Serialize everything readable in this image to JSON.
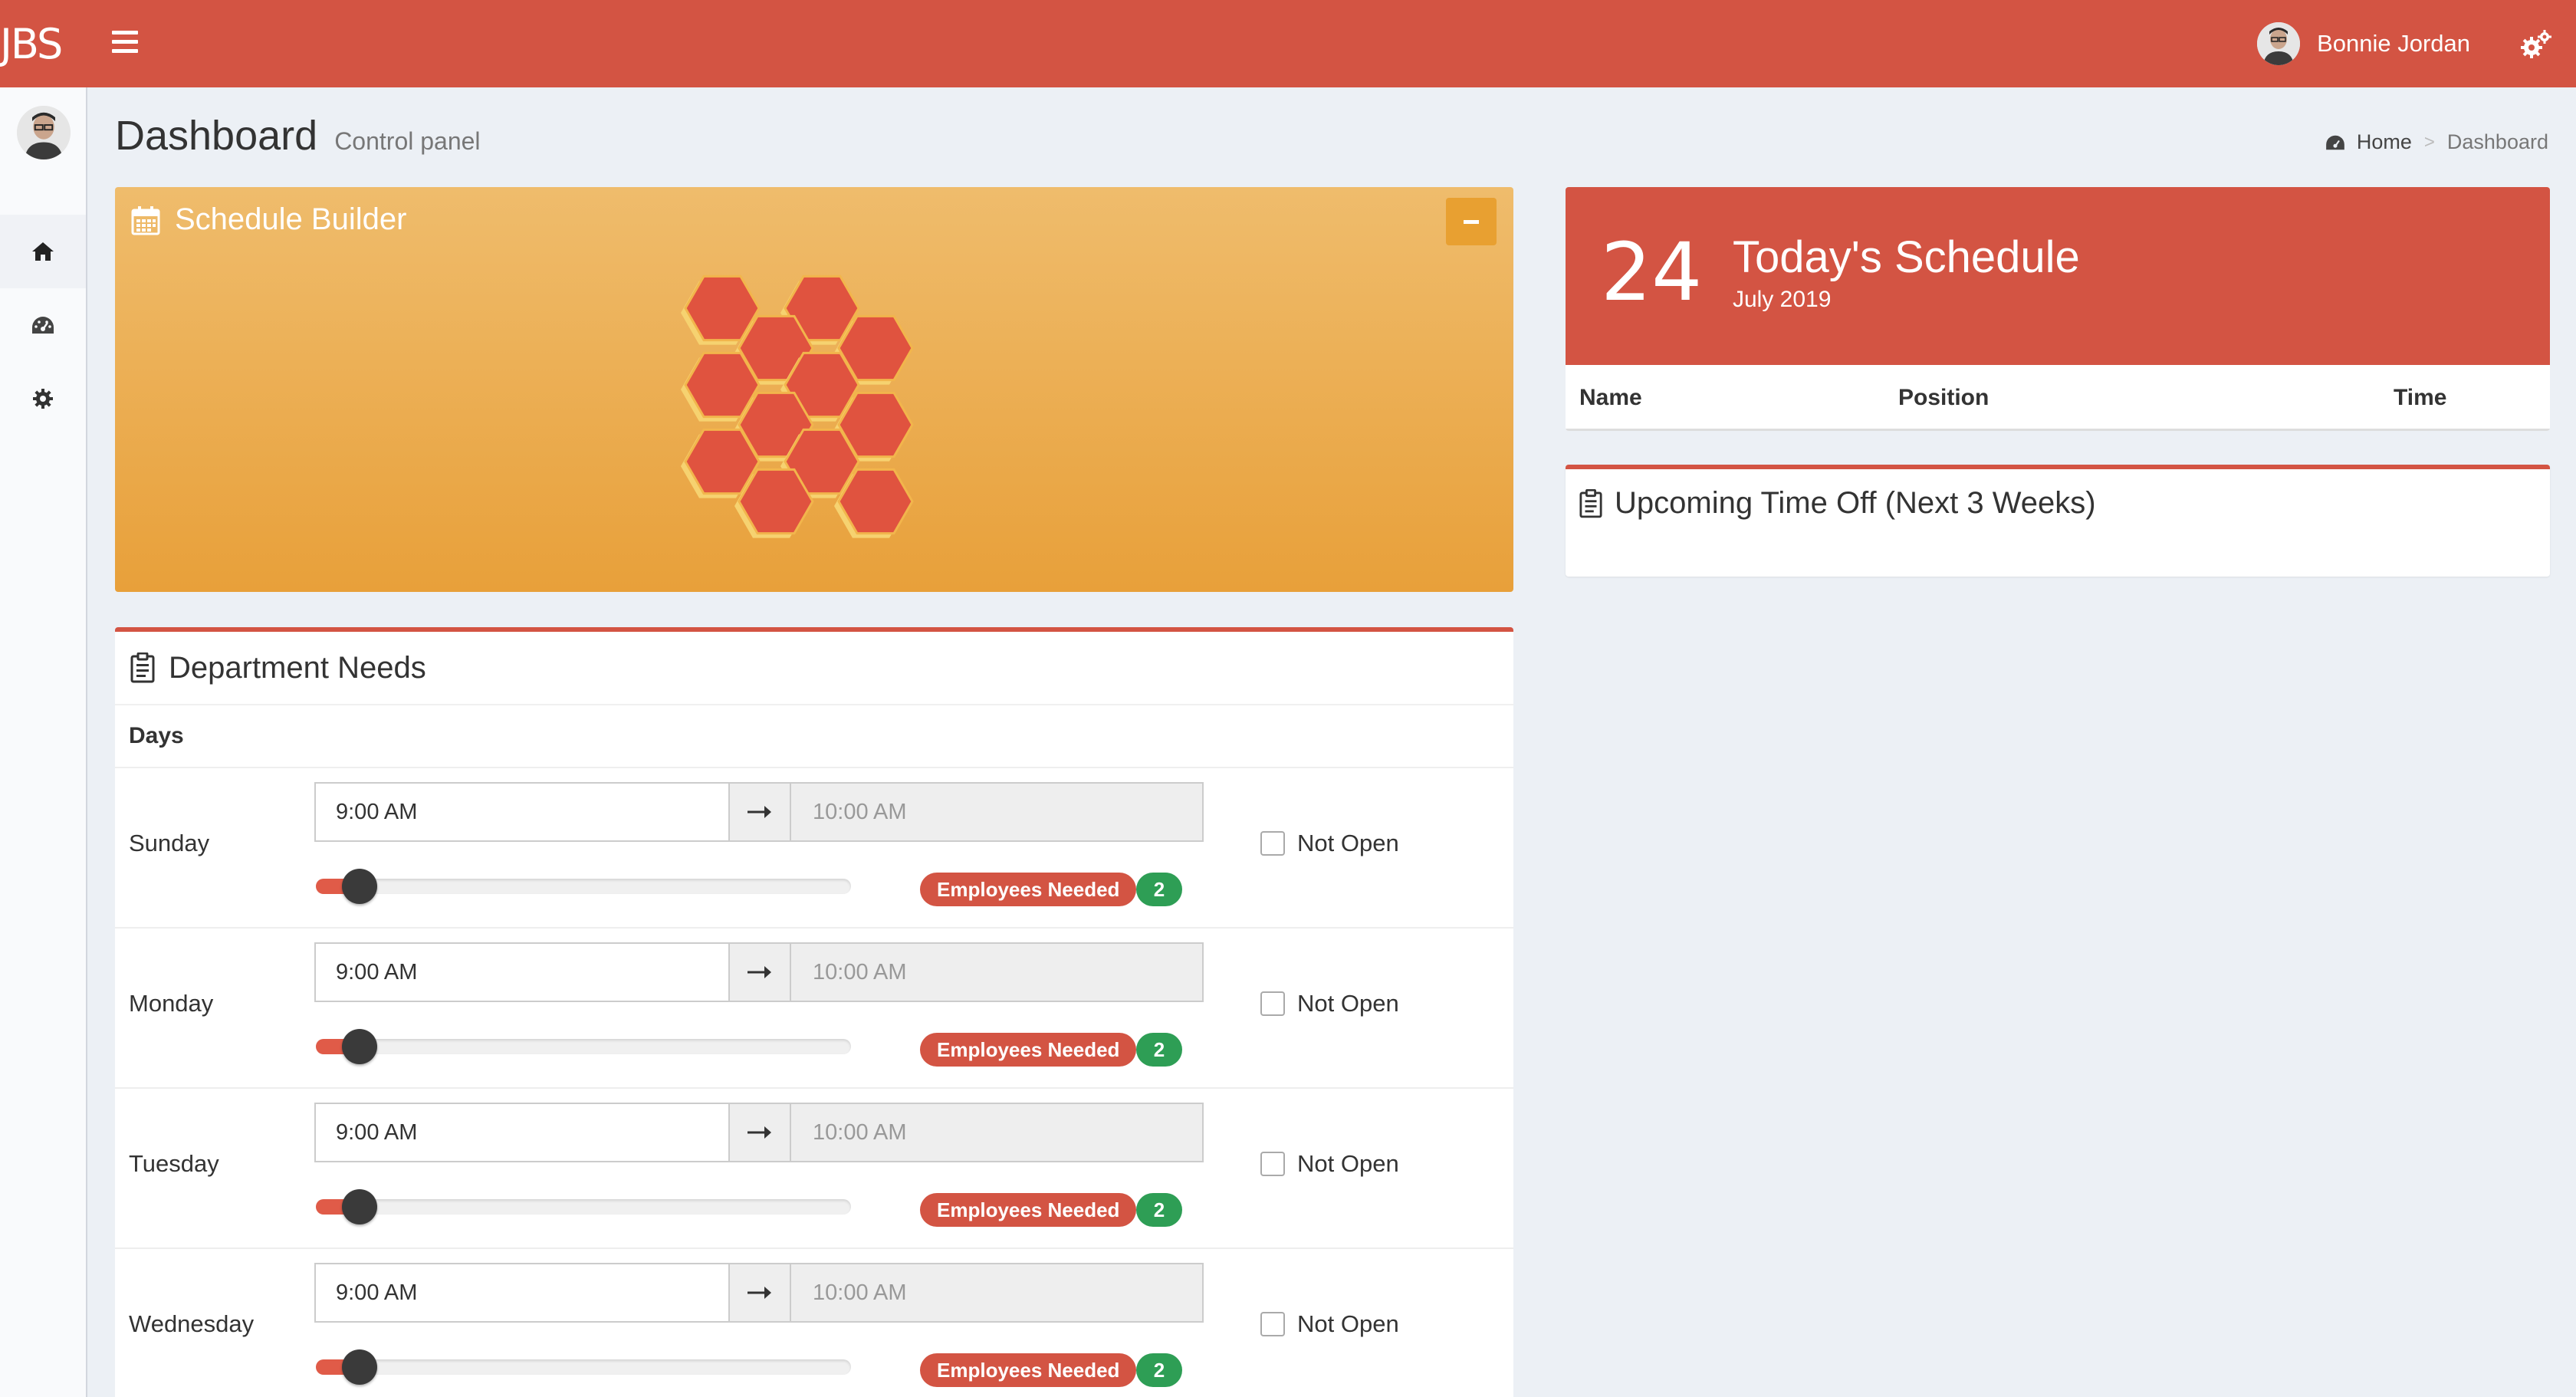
{
  "app": {
    "logo": "JBS"
  },
  "header": {
    "user_name": "Bonnie Jordan",
    "menu_icon": "hamburger-icon",
    "settings_icon": "gears-icon"
  },
  "sidebar": {
    "items": [
      {
        "icon": "home-icon"
      },
      {
        "icon": "dashboard-icon"
      },
      {
        "icon": "gear-icon"
      }
    ]
  },
  "content_header": {
    "title": "Dashboard",
    "subtitle": "Control panel"
  },
  "breadcrumb": {
    "home": "Home",
    "current": "Dashboard"
  },
  "schedule_builder": {
    "title": "Schedule Builder",
    "icon": "calendar-icon"
  },
  "department_needs": {
    "title": "Department Needs",
    "days_header": "Days",
    "rows": [
      {
        "day": "Sunday",
        "start": "9:00 AM",
        "end": "10:00 AM",
        "badge": "Employees Needed",
        "count": "2",
        "not_open": "Not Open"
      },
      {
        "day": "Monday",
        "start": "9:00 AM",
        "end": "10:00 AM",
        "badge": "Employees Needed",
        "count": "2",
        "not_open": "Not Open"
      },
      {
        "day": "Tuesday",
        "start": "9:00 AM",
        "end": "10:00 AM",
        "badge": "Employees Needed",
        "count": "2",
        "not_open": "Not Open"
      },
      {
        "day": "Wednesday",
        "start": "9:00 AM",
        "end": "10:00 AM",
        "badge": "Employees Needed",
        "count": "2",
        "not_open": "Not Open"
      }
    ]
  },
  "today": {
    "day": "24",
    "title": "Today's Schedule",
    "subtitle": "July 2019",
    "columns": {
      "name": "Name",
      "position": "Position",
      "time": "Time"
    }
  },
  "time_off": {
    "title": "Upcoming Time Off (Next 3 Weeks)"
  },
  "colors": {
    "brand": "#d35443",
    "accent": "#e8a03a",
    "badge_green": "#2e9e55"
  }
}
